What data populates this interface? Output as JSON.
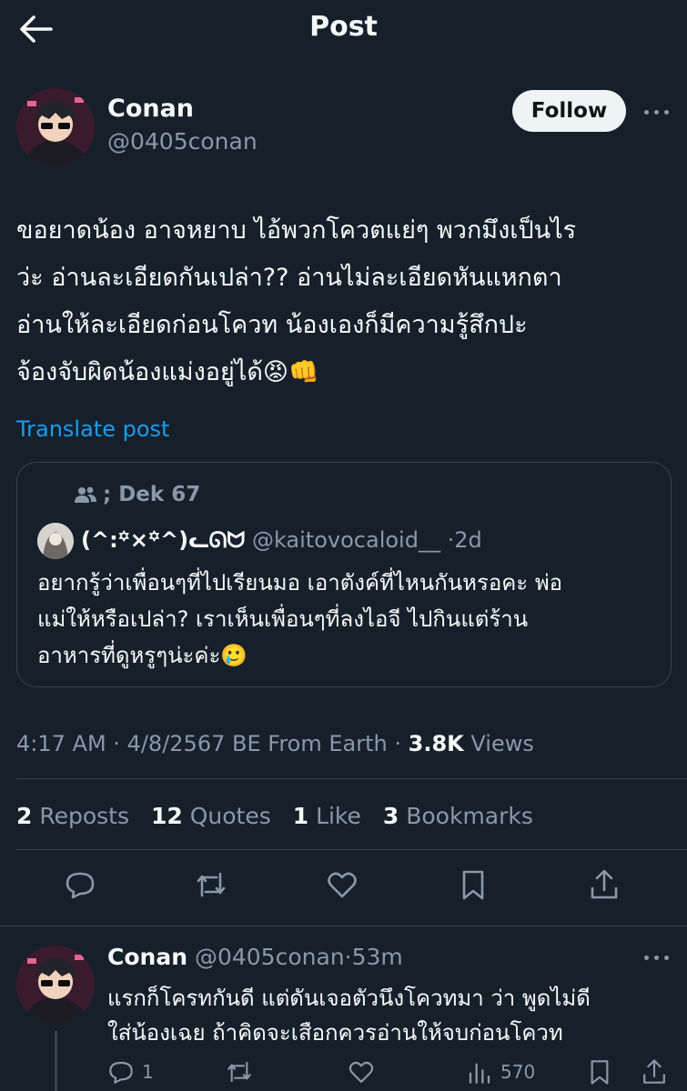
{
  "header": {
    "title": "Post"
  },
  "author": {
    "name": "Conan",
    "handle": "@0405conan",
    "follow_label": "Follow"
  },
  "post": {
    "text": "ขอยาดน้อง อาจหยาบ ไอ้พวกโควตแย่ๆ พวกมึงเป็นไร\nว่ะ อ่านละเอียดกันเปล่า?? อ่านไม่ละเอียดหันแหกตา\nอ่านให้ละเอียดก่อนโควท น้องเองก็มีความรู้สึกปะ\nจ้องจับผิดน้องแม่งอยู่ได้😡👊",
    "translate_label": "Translate post"
  },
  "quote": {
    "community": "; Dek 67",
    "name": "(^:꙳×꙳^)ᓚᘏᗢ",
    "handle": "@kaitovocaloid__",
    "time": "2d",
    "text": "อยากรู้ว่าเพื่อนๆที่ไปเรียนมอ เอาตังค์ที่ไหนกันหรอคะ พ่อ\nแม่ให้หรือเปล่า? เราเห็นเพื่อนๆที่ลงไอจี ไปกินแต่ร้าน\nอาหารที่ดูหรูๆน่ะค่ะ🥲"
  },
  "meta": {
    "time": "4:17 AM",
    "date": "4/8/2567 BE",
    "source": "From Earth",
    "views_count": "3.8K",
    "views_label": "Views"
  },
  "stats": [
    {
      "count": "2",
      "label": "Reposts"
    },
    {
      "count": "12",
      "label": "Quotes"
    },
    {
      "count": "1",
      "label": "Like"
    },
    {
      "count": "3",
      "label": "Bookmarks"
    }
  ],
  "reply": {
    "name": "Conan",
    "handle": "@0405conan",
    "time": "53m",
    "text": "แรกก็โครทกันดี  แต่ดันเจอตัวนึงโควทมา ว่า พูดไม่ดี\nใส่น้องเฉย ถ้าคิดจะเสือกควรอ่านให้จบก่อนโควท",
    "reply_count": "1",
    "views_count": "570"
  },
  "colors": {
    "background": "#15202b",
    "text": "#f7f9f9",
    "muted": "#8b98a5",
    "accent": "#1d9bf0",
    "border": "#38444d"
  }
}
